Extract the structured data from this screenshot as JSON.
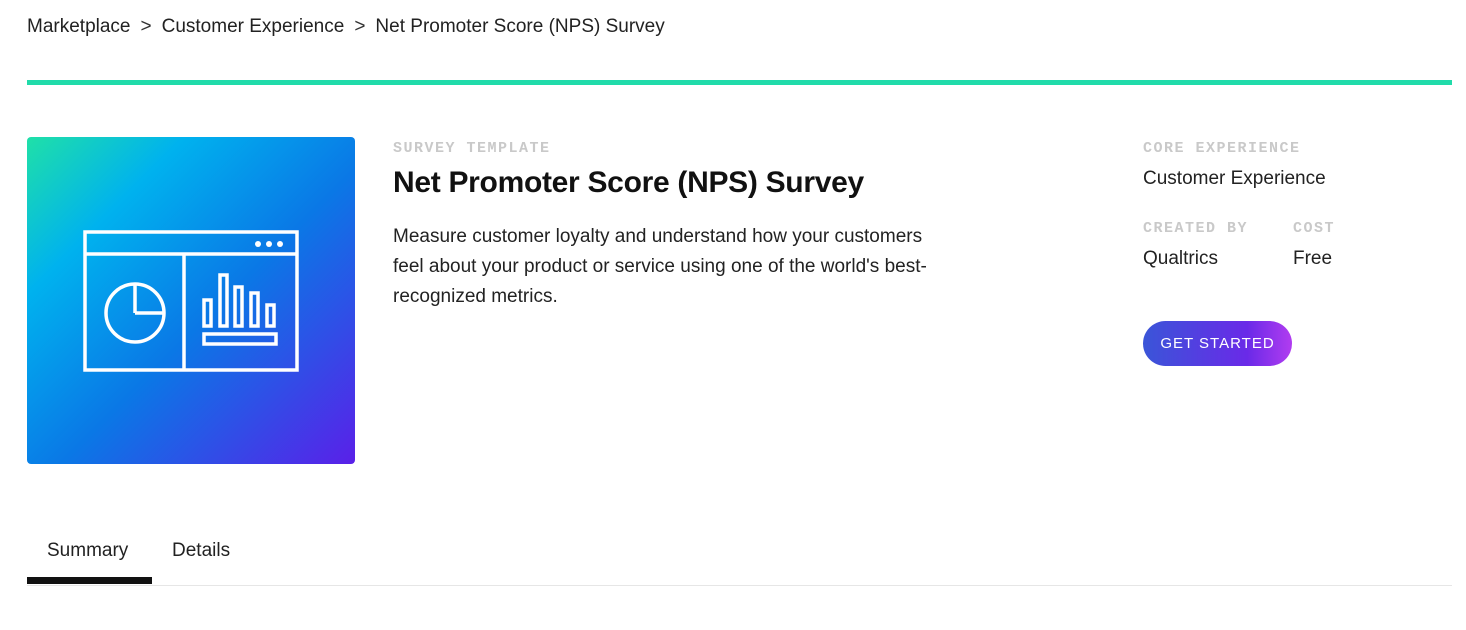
{
  "breadcrumb": {
    "items": [
      "Marketplace",
      "Customer Experience",
      "Net Promoter Score (NPS) Survey"
    ],
    "separator": ">"
  },
  "colors": {
    "accent": "#21dbaa",
    "cta_gradient_start": "#3a55d8",
    "cta_gradient_end": "#b13cf0"
  },
  "hero": {
    "icon": "dashboard-window-icon"
  },
  "template": {
    "eyebrow": "SURVEY TEMPLATE",
    "title": "Net Promoter Score (NPS) Survey",
    "description": "Measure customer loyalty and understand how your customers feel about your product or service using one of the world's best-recognized metrics."
  },
  "meta": {
    "core_experience_label": "CORE EXPERIENCE",
    "core_experience_value": "Customer Experience",
    "created_by_label": "CREATED BY",
    "created_by_value": "Qualtrics",
    "cost_label": "COST",
    "cost_value": "Free"
  },
  "cta": {
    "label": "GET STARTED"
  },
  "tabs": {
    "summary": "Summary",
    "details": "Details",
    "active": "Summary"
  }
}
